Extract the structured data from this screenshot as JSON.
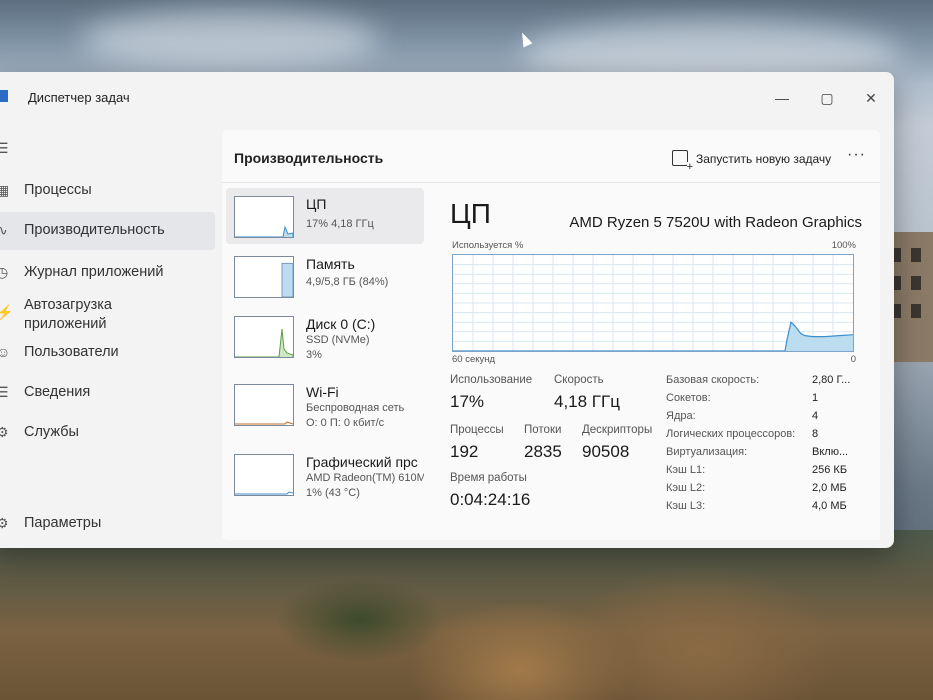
{
  "window": {
    "title": "Диспетчер задач",
    "controls": {
      "minimize": "—",
      "maximize": "▢",
      "close": "✕"
    }
  },
  "nav": {
    "menu_icon": "hamburger-icon",
    "items": [
      {
        "label": "Процессы",
        "icon": "processes-icon"
      },
      {
        "label": "Производительность",
        "icon": "performance-icon",
        "active": true
      },
      {
        "label": "Журнал приложений",
        "icon": "history-icon"
      },
      {
        "label": "Автозагрузка приложений",
        "line1": "Автозагрузка",
        "line2": "приложений",
        "icon": "startup-icon"
      },
      {
        "label": "Пользователи",
        "icon": "users-icon"
      },
      {
        "label": "Сведения",
        "icon": "details-icon"
      },
      {
        "label": "Службы",
        "icon": "services-icon"
      }
    ],
    "settings": {
      "label": "Параметры",
      "icon": "gear-icon"
    }
  },
  "header": {
    "title": "Производительность",
    "new_task": "Запустить новую задачу",
    "more": "···"
  },
  "resources": [
    {
      "name": "ЦП",
      "sub1": "17% 4,18 ГГц",
      "sub2": "",
      "sub3": "",
      "active": true
    },
    {
      "name": "Память",
      "sub1": "4,9/5,8 ГБ (84%)",
      "sub2": "",
      "sub3": "",
      "fill": 0.84
    },
    {
      "name": "Диск 0 (C:)",
      "sub1": "SSD (NVMe)",
      "sub2": "3%",
      "sub3": ""
    },
    {
      "name": "Wi-Fi",
      "sub1": "Беспроводная сеть",
      "sub2": "О: 0 П: 0 кбит/с",
      "sub3": ""
    },
    {
      "name": "Графический прс",
      "sub1": "AMD Radeon(TM) 610M",
      "sub2": "1% (43 °C)",
      "sub3": ""
    }
  ],
  "detail": {
    "title": "ЦП",
    "model": "AMD Ryzen 5 7520U with Radeon Graphics",
    "graph": {
      "top_left": "Используется %",
      "top_right": "100%",
      "bottom_left": "60 секунд",
      "bottom_right": "0"
    },
    "stats": {
      "usage_label": "Использование",
      "usage_value": "17%",
      "speed_label": "Скорость",
      "speed_value": "4,18 ГГц",
      "processes_label": "Процессы",
      "processes_value": "192",
      "threads_label": "Потоки",
      "threads_value": "2835",
      "handles_label": "Дескрипторы",
      "handles_value": "90508",
      "uptime_label": "Время работы",
      "uptime_value": "0:04:24:16"
    },
    "specs": [
      {
        "label": "Базовая скорость:",
        "value": "2,80 Г..."
      },
      {
        "label": "Сокетов:",
        "value": "1"
      },
      {
        "label": "Ядра:",
        "value": "4"
      },
      {
        "label": "Логических процессоров:",
        "value": "8"
      },
      {
        "label": "Виртуализация:",
        "value": "Вклю..."
      },
      {
        "label": "Кэш L1:",
        "value": "256 КБ"
      },
      {
        "label": "Кэш L2:",
        "value": "2,0 МБ"
      },
      {
        "label": "Кэш L3:",
        "value": "4,0 МБ"
      }
    ]
  },
  "colors": {
    "graph_line": "#3a8fd0",
    "graph_fill": "#bcdcf0",
    "graph_grid": "#d8e6f1"
  }
}
